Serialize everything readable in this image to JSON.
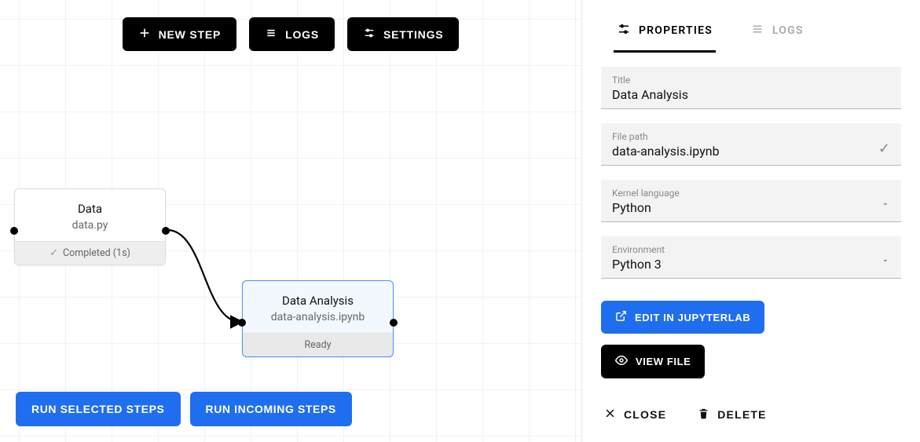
{
  "toolbar": {
    "new_step": "NEW STEP",
    "logs": "LOGS",
    "settings": "SETTINGS",
    "run_selected": "RUN SELECTED STEPS",
    "run_incoming": "RUN INCOMING STEPS"
  },
  "nodes": {
    "data": {
      "title": "Data",
      "file": "data.py",
      "status": "Completed (1s)"
    },
    "analysis": {
      "title": "Data Analysis",
      "file": "data-analysis.ipynb",
      "status": "Ready"
    }
  },
  "panel": {
    "tabs": {
      "properties": "PROPERTIES",
      "logs": "LOGS"
    },
    "fields": {
      "title_label": "Title",
      "title_value": "Data Analysis",
      "filepath_label": "File path",
      "filepath_value": "data-analysis.ipynb",
      "kernel_label": "Kernel language",
      "kernel_value": "Python",
      "env_label": "Environment",
      "env_value": "Python 3"
    },
    "actions": {
      "edit_jupyter": "EDIT IN JUPYTERLAB",
      "view_file": "VIEW FILE",
      "close": "CLOSE",
      "delete": "DELETE"
    }
  }
}
